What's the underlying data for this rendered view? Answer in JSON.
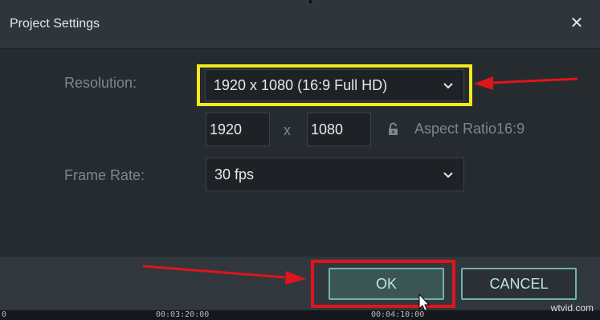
{
  "dialog": {
    "title": "Project Settings",
    "close_icon": "close-icon"
  },
  "resolution": {
    "label": "Resolution:",
    "selected": "1920 x 1080 (16:9 Full HD)",
    "width": "1920",
    "times": "x",
    "height": "1080",
    "lock_icon": "lock-icon",
    "aspect_ratio": "Aspect Ratio16:9"
  },
  "frame_rate": {
    "label": "Frame Rate:",
    "selected": "30 fps"
  },
  "buttons": {
    "ok": "OK",
    "cancel": "CANCEL"
  },
  "timeline": {
    "timecodes": [
      "0",
      "00:03:20:00",
      "00:04:10:00"
    ]
  },
  "watermark": "wtvid.com",
  "colors": {
    "highlight_yellow": "#f1ea1c",
    "highlight_red": "#e0141b",
    "button_accent": "#6fb3ad"
  }
}
